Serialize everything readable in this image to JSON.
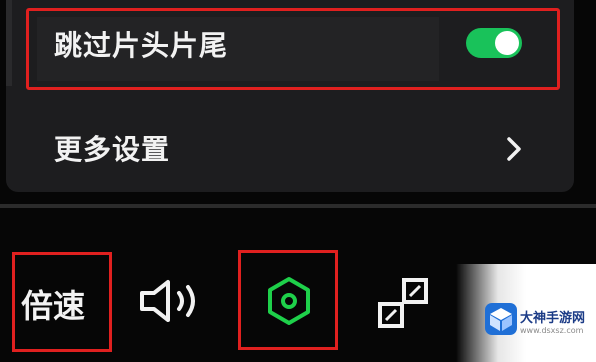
{
  "menu": {
    "skip_intro_outro": {
      "label": "跳过片头片尾",
      "enabled": true,
      "toggle_color": "#19c25a"
    },
    "more_settings": {
      "label": "更多设置",
      "icon": "chevron-right-icon"
    }
  },
  "controls": {
    "speed_label": "倍速",
    "volume_icon": "volume-icon",
    "settings_icon": "settings-hexagon-icon",
    "settings_icon_color": "#1ed04a",
    "exit_fullscreen_icon": "exit-fullscreen-icon"
  },
  "highlight_color": "#e0201f",
  "watermark": {
    "title": "大神手游网",
    "url": "www.dsxsz.com"
  }
}
